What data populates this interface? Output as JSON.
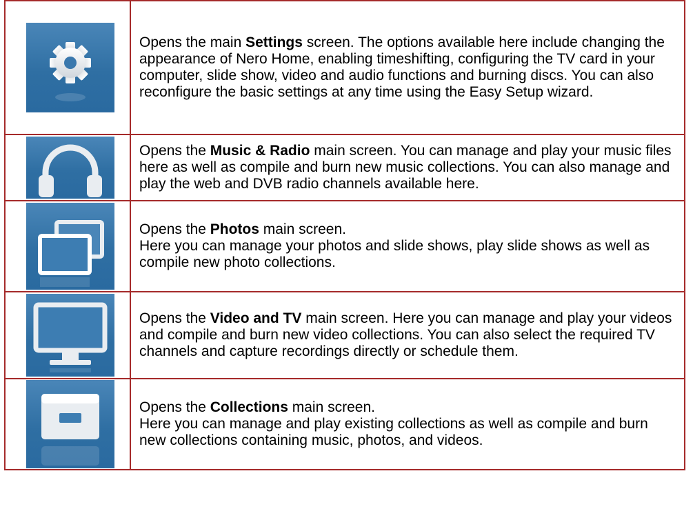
{
  "rows": [
    {
      "icon": "settings-gear-icon",
      "prefix": "Opens the main ",
      "bold": "Settings",
      "suffix": " screen. The options available here include changing the appearance of Nero Home, enabling timeshifting, configuring the TV card in your computer, slide show, video and audio functions and burning discs. You can also reconfigure the basic settings at any time using the Easy Setup wizard.",
      "line2": ""
    },
    {
      "icon": "headphones-icon",
      "prefix": "Opens the ",
      "bold": "Music & Radio",
      "suffix": " main screen. You can manage and play your music files here as well as compile and burn new music collections. You can also manage and play the web and DVB radio channels available here.",
      "line2": ""
    },
    {
      "icon": "photos-stack-icon",
      "prefix": "Opens the ",
      "bold": "Photos",
      "suffix": " main screen.",
      "line2": "Here you can manage your photos and slide shows, play slide shows as well as compile new photo collections."
    },
    {
      "icon": "tv-monitor-icon",
      "prefix": "Opens the ",
      "bold": "Video and TV",
      "suffix": " main screen. Here you can manage and play your videos and compile and burn new video collections. You can also select the required TV channels and capture recordings directly or schedule them.",
      "line2": ""
    },
    {
      "icon": "collections-box-icon",
      "prefix": "Opens the ",
      "bold": "Collections",
      "suffix": " main screen.",
      "line2": "Here you can manage and play existing collections as well as compile and burn new collections containing music, photos, and videos."
    }
  ]
}
